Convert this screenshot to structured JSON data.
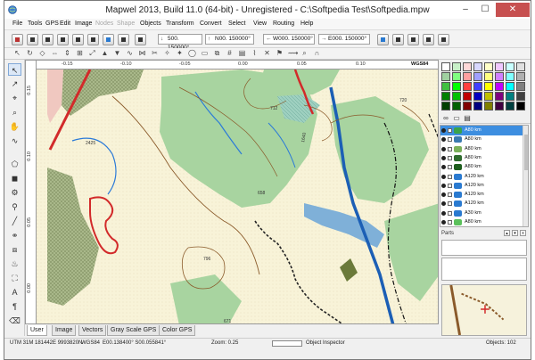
{
  "window": {
    "title": "Mapwel 2013, Build 11.0 (64-bit) - Unregistered - C:\\Softpedia Test\\Softpedia.mpw",
    "minimize": "–",
    "maximize": "☐",
    "close": "✕"
  },
  "menu": [
    {
      "label": "File",
      "enabled": true
    },
    {
      "label": "Tools",
      "enabled": true
    },
    {
      "label": "GPS",
      "enabled": true
    },
    {
      "label": "Edit",
      "enabled": true
    },
    {
      "label": "Image",
      "enabled": true
    },
    {
      "label": "Nodes",
      "enabled": false
    },
    {
      "label": "Shape",
      "enabled": false
    },
    {
      "label": "Objects",
      "enabled": true
    },
    {
      "label": "Transform",
      "enabled": true
    },
    {
      "label": "Convert",
      "enabled": true
    },
    {
      "label": "Select",
      "enabled": true
    },
    {
      "label": "View",
      "enabled": true
    },
    {
      "label": "Routing",
      "enabled": true
    },
    {
      "label": "Help",
      "enabled": true
    }
  ],
  "coords": {
    "s": {
      "prefix": "S",
      "value": "500. 150000°"
    },
    "n": {
      "prefix": "N",
      "value": "N00. 150000°"
    },
    "w": {
      "prefix": "W",
      "value": "W000. 150000°"
    },
    "e": {
      "prefix": "E",
      "value": "E000. 150000°"
    }
  },
  "ruler": {
    "top": [
      "-0.15",
      "-0.10",
      "-0.05",
      "0.00",
      "0.05",
      "0.10"
    ],
    "left": [
      "0.15",
      "0.10",
      "0.05",
      "0.00"
    ],
    "datum": "WGS84"
  },
  "map_labels": {
    "l712": "712",
    "l720": "720",
    "l2425": "2425",
    "l1640": "1640",
    "l658": "658",
    "l796": "796",
    "l671": "671"
  },
  "tabs": [
    "User",
    "Image",
    "Vectors",
    "Gray Scale GPS",
    "Color GPS"
  ],
  "status": {
    "utm": "UTM 31M 181442E 9993820N",
    "datum": "WGS84",
    "pos": "E00.138400° S00.055841°",
    "zoom": "Zoom: 0.25",
    "inspector": "Object Inspector",
    "objects": "Objects: 102"
  },
  "palette_colors": [
    "#ffffff",
    "#c8f0c8",
    "#ffd8d8",
    "#d8d8ff",
    "#ffffc8",
    "#f0c8ff",
    "#c8ffff",
    "#e0e0e0",
    "#a0d0a0",
    "#80ff80",
    "#ffa0a0",
    "#a0a0ff",
    "#ffff80",
    "#d080ff",
    "#80ffff",
    "#b0b0b0",
    "#40c040",
    "#00ff00",
    "#ff4040",
    "#4040ff",
    "#ffff00",
    "#c000ff",
    "#00ffff",
    "#808080",
    "#008000",
    "#00c000",
    "#c00000",
    "#0000c0",
    "#c0c000",
    "#800080",
    "#008080",
    "#404040",
    "#004000",
    "#006000",
    "#800000",
    "#000080",
    "#808000",
    "#400040",
    "#004040",
    "#000000"
  ],
  "layers": [
    {
      "label": "A80 km",
      "color": "#3aa34a",
      "selected": true
    },
    {
      "label": "A80 km",
      "color": "#3a7ab0",
      "selected": false
    },
    {
      "label": "A80 km",
      "color": "#7ab05a",
      "selected": false
    },
    {
      "label": "A80 km",
      "color": "#2e6b2e",
      "selected": false
    },
    {
      "label": "A80 km",
      "color": "#1e5e1e",
      "selected": false
    },
    {
      "label": "A120 km",
      "color": "#2a7ad0",
      "selected": false
    },
    {
      "label": "A120 km",
      "color": "#2a7ad0",
      "selected": false
    },
    {
      "label": "A120 km",
      "color": "#2a7ad0",
      "selected": false
    },
    {
      "label": "A120 km",
      "color": "#2a7ad0",
      "selected": false
    },
    {
      "label": "A30 km",
      "color": "#2a7ad0",
      "selected": false
    },
    {
      "label": "A80 km",
      "color": "#5ac05a",
      "selected": false
    }
  ],
  "parts": {
    "label": "Parts",
    "close": "x",
    "up": "▴",
    "down": "▾"
  }
}
